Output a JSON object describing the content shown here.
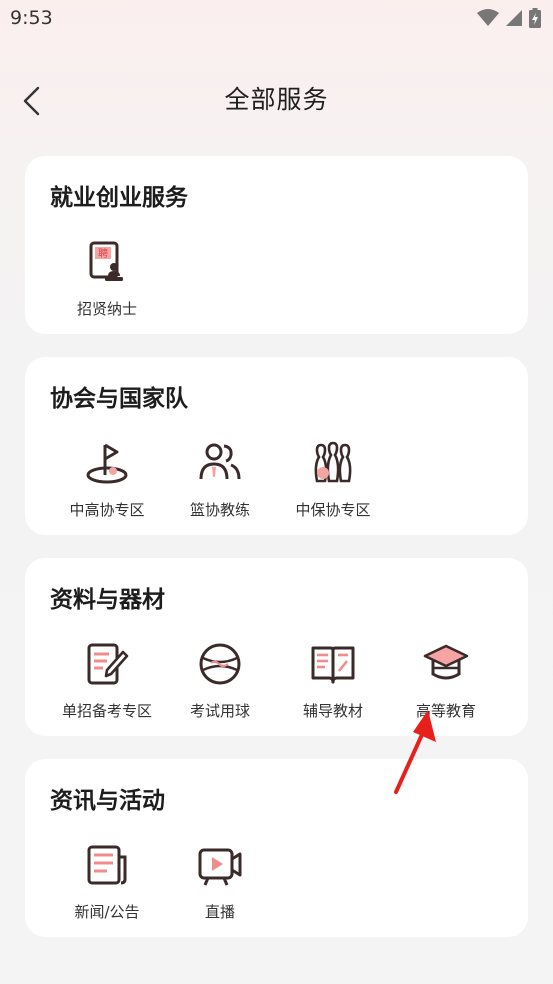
{
  "status_bar": {
    "time": "9:53"
  },
  "nav": {
    "title": "全部服务"
  },
  "sections": [
    {
      "title": "就业创业服务",
      "items": [
        {
          "label": "招贤纳士",
          "icon": "recruit-stamp-icon"
        }
      ]
    },
    {
      "title": "协会与国家队",
      "items": [
        {
          "label": "中高协专区",
          "icon": "golf-flag-icon"
        },
        {
          "label": "篮协教练",
          "icon": "coach-people-icon"
        },
        {
          "label": "中保协专区",
          "icon": "bowling-pins-icon"
        }
      ]
    },
    {
      "title": "资料与器材",
      "items": [
        {
          "label": "单招备考专区",
          "icon": "exam-pen-icon"
        },
        {
          "label": "考试用球",
          "icon": "ball-icon"
        },
        {
          "label": "辅导教材",
          "icon": "open-book-icon"
        },
        {
          "label": "高等教育",
          "icon": "graduation-cap-icon"
        }
      ]
    },
    {
      "title": "资讯与活动",
      "items": [
        {
          "label": "新闻/公告",
          "icon": "newspaper-icon"
        },
        {
          "label": "直播",
          "icon": "live-video-icon"
        }
      ]
    }
  ],
  "colors": {
    "accent": "#f08c8c",
    "ink": "#3b2a2a",
    "annotation_arrow": "#e8201c"
  }
}
